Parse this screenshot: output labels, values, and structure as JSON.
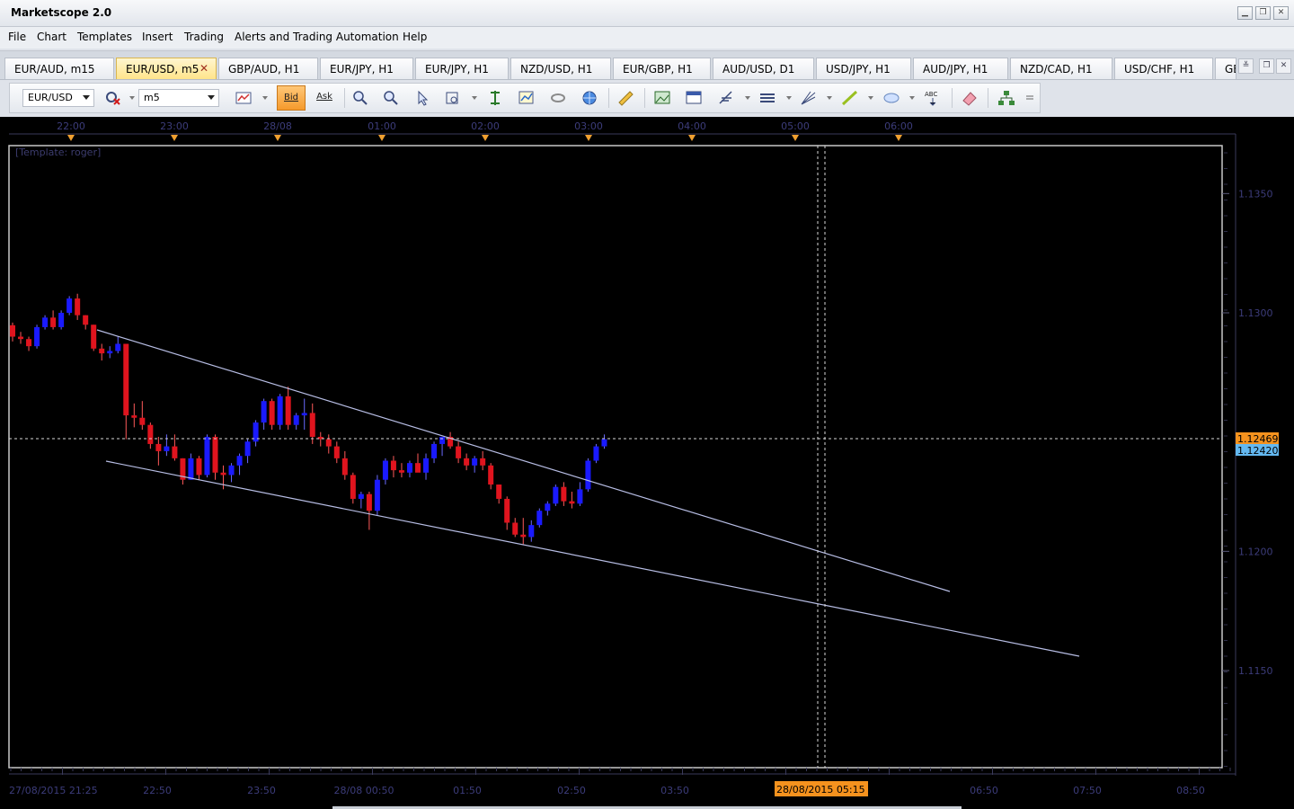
{
  "window": {
    "title": "Marketscope 2.0"
  },
  "menu": [
    "File",
    "Chart",
    "Templates",
    "Insert",
    "Trading",
    "Alerts and Trading Automation",
    "Help"
  ],
  "tabs": [
    {
      "label": "EUR/AUD, m15",
      "active": false
    },
    {
      "label": "EUR/USD, m5",
      "active": true
    },
    {
      "label": "GBP/AUD, H1",
      "active": false
    },
    {
      "label": "EUR/JPY, H1",
      "active": false
    },
    {
      "label": "EUR/JPY, H1",
      "active": false
    },
    {
      "label": "NZD/USD, H1",
      "active": false
    },
    {
      "label": "EUR/GBP, H1",
      "active": false
    },
    {
      "label": "AUD/USD, D1",
      "active": false
    },
    {
      "label": "USD/JPY, H1",
      "active": false
    },
    {
      "label": "AUD/JPY, H1",
      "active": false
    },
    {
      "label": "NZD/CAD, H1",
      "active": false
    },
    {
      "label": "USD/CHF, H1",
      "active": false
    },
    {
      "label": "GE",
      "active": false
    }
  ],
  "toolbar": {
    "symbol": "EUR/USD",
    "timeframe": "m5",
    "bid_label": "Bid",
    "ask_label": "Ask"
  },
  "colors": {
    "bull": "#1a1aff",
    "bear": "#e0141e",
    "bid_price_bg": "#f5921e",
    "ask_price_bg": "#63b8f0",
    "trendline": "#b7bde4",
    "axis_text": "#3c3c7a"
  },
  "chart_data": {
    "type": "candlestick",
    "template_label": "[Template: roger]",
    "top_axis_labels": [
      "22:00",
      "23:00",
      "28/08",
      "01:00",
      "02:00",
      "03:00",
      "04:00",
      "05:00",
      "06:00"
    ],
    "bottom_axis_labels": [
      "27/08/2015 21:25",
      "22:50",
      "23:50",
      "28/08 00:50",
      "01:50",
      "02:50",
      "03:50",
      "06:50",
      "07:50",
      "08:50"
    ],
    "price_ticks": [
      "1.1350",
      "1.1300",
      "1.1200",
      "1.1150"
    ],
    "ylim": [
      1.112,
      1.1375
    ],
    "bid_price": "1.12469",
    "ask_price": "1.12420",
    "crosshair_time": "28/08/2015 05:15",
    "candles": [
      [
        1.12948,
        1.12959,
        1.1288,
        1.129
      ],
      [
        1.129,
        1.1292,
        1.1287,
        1.1289
      ],
      [
        1.1289,
        1.129,
        1.1284,
        1.1286
      ],
      [
        1.1286,
        1.1295,
        1.1285,
        1.1294
      ],
      [
        1.1294,
        1.1299,
        1.1293,
        1.1298
      ],
      [
        1.1298,
        1.1301,
        1.1293,
        1.1294
      ],
      [
        1.1294,
        1.1301,
        1.1293,
        1.13
      ],
      [
        1.13,
        1.1307,
        1.1299,
        1.1306
      ],
      [
        1.1306,
        1.1308,
        1.1297,
        1.1299
      ],
      [
        1.1299,
        1.1299,
        1.1293,
        1.1295
      ],
      [
        1.1295,
        1.1295,
        1.1284,
        1.1285
      ],
      [
        1.1285,
        1.1287,
        1.128,
        1.1283
      ],
      [
        1.1283,
        1.1286,
        1.1281,
        1.1284
      ],
      [
        1.1284,
        1.129,
        1.1283,
        1.1287
      ],
      [
        1.1287,
        1.1287,
        1.1247,
        1.1257
      ],
      [
        1.1257,
        1.1262,
        1.1252,
        1.1256
      ],
      [
        1.1256,
        1.1263,
        1.1251,
        1.1253
      ],
      [
        1.1253,
        1.1254,
        1.1243,
        1.1245
      ],
      [
        1.1245,
        1.1248,
        1.1236,
        1.1242
      ],
      [
        1.1242,
        1.1249,
        1.124,
        1.1244
      ],
      [
        1.1244,
        1.1249,
        1.1238,
        1.1239
      ],
      [
        1.1239,
        1.1239,
        1.1228,
        1.123
      ],
      [
        1.123,
        1.1241,
        1.123,
        1.1239
      ],
      [
        1.1239,
        1.124,
        1.123,
        1.1232
      ],
      [
        1.1232,
        1.1249,
        1.1231,
        1.1248
      ],
      [
        1.1248,
        1.1249,
        1.123,
        1.1233
      ],
      [
        1.1233,
        1.1236,
        1.1226,
        1.1232
      ],
      [
        1.1232,
        1.1237,
        1.1229,
        1.1236
      ],
      [
        1.1236,
        1.1241,
        1.1232,
        1.124
      ],
      [
        1.124,
        1.1247,
        1.1237,
        1.1246
      ],
      [
        1.1246,
        1.1255,
        1.1244,
        1.1254
      ],
      [
        1.1254,
        1.1264,
        1.1251,
        1.1263
      ],
      [
        1.1263,
        1.1264,
        1.1251,
        1.1253
      ],
      [
        1.1253,
        1.1266,
        1.1251,
        1.1265
      ],
      [
        1.1265,
        1.1269,
        1.1251,
        1.1253
      ],
      [
        1.1253,
        1.1258,
        1.1251,
        1.1257
      ],
      [
        1.1257,
        1.1264,
        1.1251,
        1.1258
      ],
      [
        1.1258,
        1.1262,
        1.1245,
        1.1248
      ],
      [
        1.1248,
        1.125,
        1.1244,
        1.1247
      ],
      [
        1.1247,
        1.1249,
        1.1241,
        1.1244
      ],
      [
        1.1244,
        1.1246,
        1.1237,
        1.1239
      ],
      [
        1.1239,
        1.1242,
        1.123,
        1.1232
      ],
      [
        1.1232,
        1.1233,
        1.122,
        1.1222
      ],
      [
        1.1222,
        1.1225,
        1.1218,
        1.1224
      ],
      [
        1.1224,
        1.1225,
        1.1209,
        1.1217
      ],
      [
        1.1217,
        1.1232,
        1.1215,
        1.123
      ],
      [
        1.123,
        1.1239,
        1.1228,
        1.1238
      ],
      [
        1.1238,
        1.124,
        1.1231,
        1.1234
      ],
      [
        1.1234,
        1.1237,
        1.1231,
        1.1233
      ],
      [
        1.1233,
        1.1238,
        1.1231,
        1.1237
      ],
      [
        1.1237,
        1.1241,
        1.1234,
        1.1233
      ],
      [
        1.1233,
        1.1241,
        1.123,
        1.1239
      ],
      [
        1.1239,
        1.1246,
        1.1237,
        1.1245
      ],
      [
        1.1245,
        1.1248,
        1.124,
        1.1248
      ],
      [
        1.1248,
        1.125,
        1.1243,
        1.1244
      ],
      [
        1.1244,
        1.1246,
        1.1237,
        1.1239
      ],
      [
        1.1239,
        1.1241,
        1.1234,
        1.1236
      ],
      [
        1.1236,
        1.124,
        1.1233,
        1.1239
      ],
      [
        1.1239,
        1.1242,
        1.1234,
        1.1236
      ],
      [
        1.1236,
        1.1237,
        1.1226,
        1.1228
      ],
      [
        1.1228,
        1.1228,
        1.122,
        1.1222
      ],
      [
        1.1222,
        1.1223,
        1.1209,
        1.1212
      ],
      [
        1.1212,
        1.1214,
        1.1206,
        1.1207
      ],
      [
        1.1207,
        1.1214,
        1.1203,
        1.1206
      ],
      [
        1.1206,
        1.1213,
        1.1204,
        1.1211
      ],
      [
        1.1211,
        1.1218,
        1.121,
        1.1217
      ],
      [
        1.1217,
        1.1221,
        1.1215,
        1.122
      ],
      [
        1.122,
        1.1228,
        1.1219,
        1.1227
      ],
      [
        1.1227,
        1.1229,
        1.1219,
        1.1221
      ],
      [
        1.1221,
        1.1225,
        1.1218,
        1.122
      ],
      [
        1.122,
        1.1229,
        1.1219,
        1.1226
      ],
      [
        1.1226,
        1.1239,
        1.1225,
        1.1238
      ],
      [
        1.1238,
        1.1245,
        1.1237,
        1.1244
      ],
      [
        1.1244,
        1.1249,
        1.1243,
        1.1247
      ]
    ]
  }
}
